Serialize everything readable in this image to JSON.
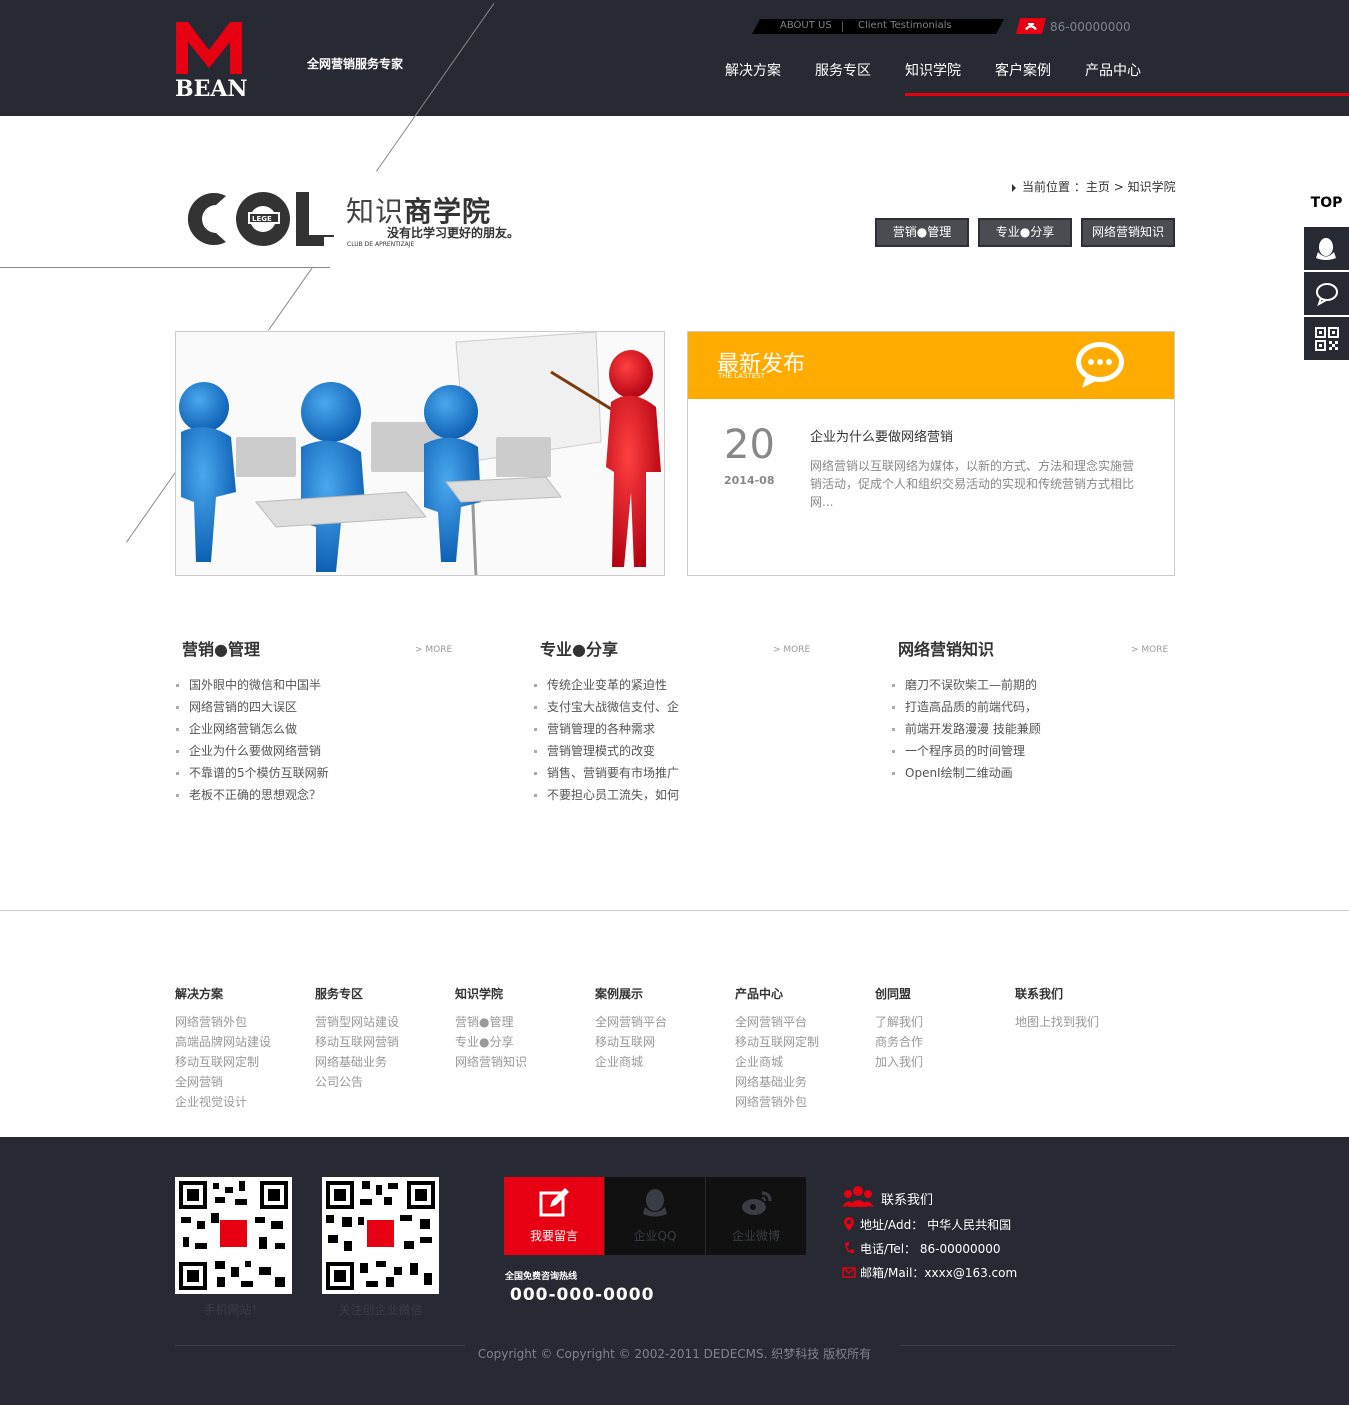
{
  "header": {
    "logo_text": "BEAN",
    "slogan": "全网营销服务专家",
    "top_links": [
      "ABOUT US",
      "Client Testimonials"
    ],
    "phone": "86-00000000",
    "nav": [
      "解决方案",
      "服务专区",
      "知识学院",
      "客户案例",
      "产品中心"
    ],
    "active_nav": "知识学院",
    "accent": "#e60012"
  },
  "page_title": {
    "logo_word": "COL",
    "logo_inner": "LEGE",
    "cn_title_light": "知识",
    "cn_title_bold": "商学院",
    "subtitle": "没有比学习更好的朋友。",
    "small_text": "CLUB DE APRENTIZAJE"
  },
  "breadcrumb": {
    "prefix": "当前位置",
    "sep": "：",
    "home": "主页",
    "arrow": ">",
    "current": "知识学院"
  },
  "categories": [
    "营销●管理",
    "专业●分享",
    "网络营销知识"
  ],
  "latest": {
    "title": "最新发布",
    "subtitle": "THE LASTEST",
    "day": "20",
    "year_month": "2014-08",
    "article_title": "企业为什么要做网络营销",
    "article_desc": "网络营销以互联网络为媒体，以新的方式、方法和理念实施营销活动，促成个人和组织交易活动的实现和传统营销方式相比网...",
    "color": "#ffab00"
  },
  "columns": [
    {
      "title": "营销●管理",
      "more": "> MORE",
      "items": [
        "国外眼中的微信和中国半",
        "网络营销的四大误区",
        "企业网络营销怎么做",
        "企业为什么要做网络营销",
        "不靠谱的5个模仿互联网新",
        "老板不正确的思想观念？"
      ]
    },
    {
      "title": "专业●分享",
      "more": "> MORE",
      "items": [
        "传统企业变革的紧迫性",
        "支付宝大战微信支付、企",
        "营销管理的各种需求",
        "营销管理模式的改变",
        "销售、营销要有市场推广",
        "不要担心员工流失，如何"
      ]
    },
    {
      "title": "网络营销知识",
      "more": "> MORE",
      "items": [
        "磨刀不误砍柴工—前期的",
        "打造高品质的前端代码，",
        "前端开发路漫漫 技能兼顾",
        "一个程序员的时间管理",
        "OpenI绘制二维动画"
      ]
    }
  ],
  "footer_links": [
    {
      "title": "解决方案",
      "items": [
        "网络营销外包",
        "高端品牌网站建设",
        "移动互联网定制",
        "全网营销",
        "企业视觉设计"
      ]
    },
    {
      "title": "服务专区",
      "items": [
        "营销型网站建设",
        "移动互联网营销",
        "网络基础业务",
        "公司公告"
      ]
    },
    {
      "title": "知识学院",
      "items": [
        "营销●管理",
        "专业●分享",
        "网络营销知识"
      ]
    },
    {
      "title": "案例展示",
      "items": [
        "全网营销平台",
        "移动互联网",
        "企业商城"
      ]
    },
    {
      "title": "产品中心",
      "items": [
        "全网营销平台",
        "移动互联网定制",
        "企业商城",
        "网络基础业务",
        "网络营销外包"
      ]
    },
    {
      "title": "创同盟",
      "items": [
        "了解我们",
        "商务合作",
        "加入我们"
      ]
    },
    {
      "title": "联系我们",
      "items": [
        "地图上找到我们"
      ]
    }
  ],
  "footer": {
    "qr_labels": [
      "手机网站！",
      "关注创企业微信"
    ],
    "buttons": [
      "我要留言",
      "企业QQ",
      "企业微博"
    ],
    "hotline_label": "全国免费咨询热线",
    "hotline": "000-000-0000",
    "contact_title": "联系我们",
    "address": "地址/Add： 中华人民共和国",
    "tel": "电话/Tel： 86-00000000",
    "mail": "邮箱/Mail：xxxx@163.com",
    "copyright": "Copyright © Copyright © 2002-2011 DEDECMS. 织梦科技 版权所有"
  },
  "side": {
    "top_label": "TOP"
  }
}
